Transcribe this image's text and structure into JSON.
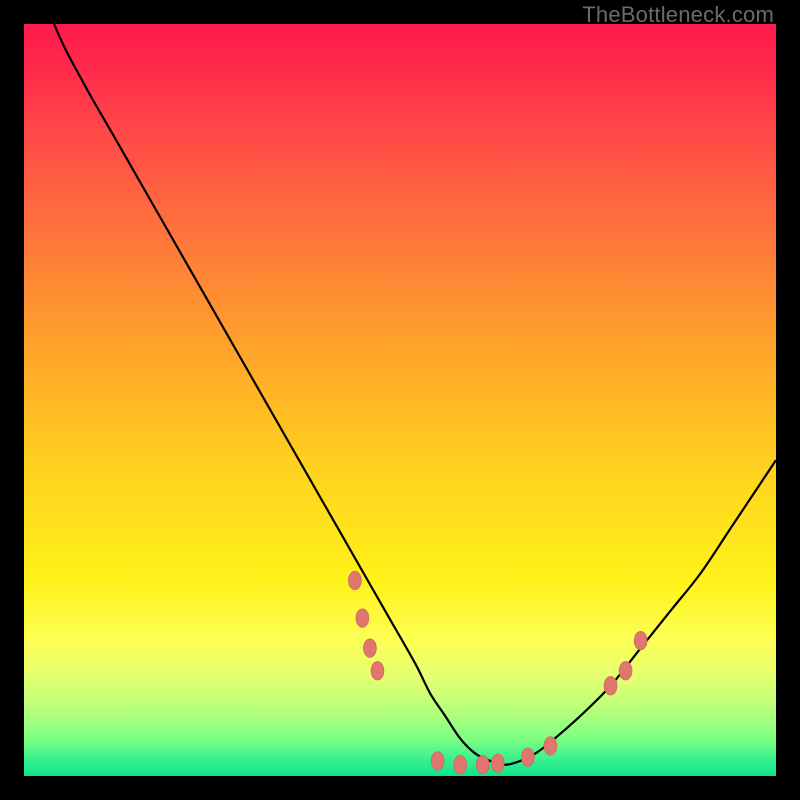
{
  "watermark": {
    "text": "TheBottleneck.com"
  },
  "colors": {
    "curve_stroke": "#000000",
    "marker_fill": "#e0776f",
    "marker_stroke": "#d2665e"
  },
  "chart_data": {
    "type": "line",
    "title": "",
    "xlabel": "",
    "ylabel": "",
    "xlim": [
      0,
      100
    ],
    "ylim": [
      0,
      100
    ],
    "series": [
      {
        "name": "bottleneck-curve",
        "x": [
          0,
          4,
          8,
          12,
          16,
          20,
          24,
          28,
          32,
          36,
          40,
          44,
          48,
          52,
          54,
          56,
          58,
          60,
          62,
          64,
          66,
          68,
          70,
          74,
          78,
          82,
          86,
          90,
          94,
          98,
          100
        ],
        "y": [
          112,
          100,
          92,
          85,
          78,
          71,
          64,
          57,
          50,
          43,
          36,
          29,
          22,
          15,
          11,
          8,
          5,
          3,
          2,
          1.5,
          2,
          3,
          4.5,
          8,
          12,
          17,
          22,
          27,
          33,
          39,
          42
        ]
      }
    ],
    "markers": [
      {
        "x": 44,
        "y": 26
      },
      {
        "x": 45,
        "y": 21
      },
      {
        "x": 46,
        "y": 17
      },
      {
        "x": 47,
        "y": 14
      },
      {
        "x": 55,
        "y": 2
      },
      {
        "x": 58,
        "y": 1.5
      },
      {
        "x": 61,
        "y": 1.5
      },
      {
        "x": 63,
        "y": 1.7
      },
      {
        "x": 67,
        "y": 2.5
      },
      {
        "x": 70,
        "y": 4
      },
      {
        "x": 78,
        "y": 12
      },
      {
        "x": 80,
        "y": 14
      },
      {
        "x": 82,
        "y": 18
      }
    ],
    "marker_radius": 8
  }
}
